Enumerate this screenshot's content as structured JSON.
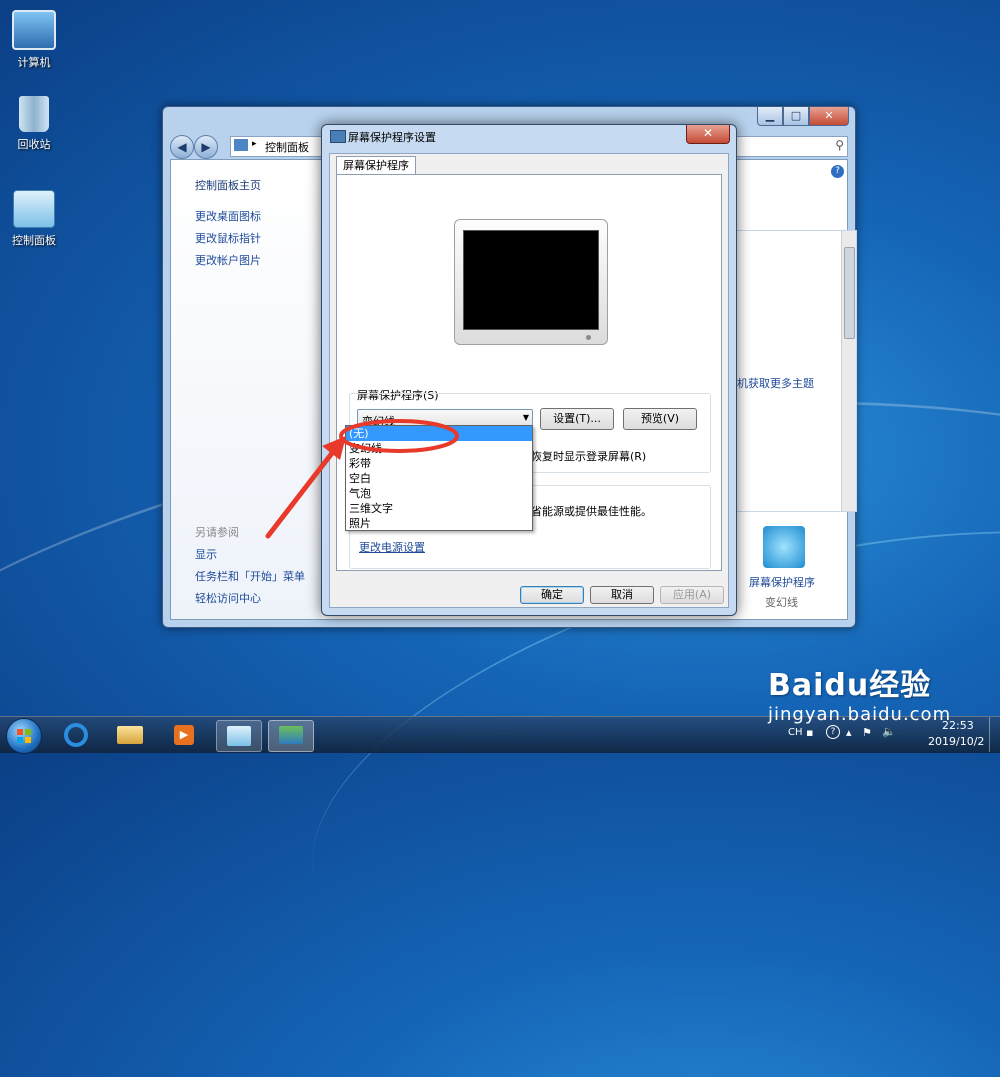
{
  "desktop": {
    "icons": [
      {
        "label": "计算机"
      },
      {
        "label": "回收站"
      },
      {
        "label": "控制面板"
      }
    ]
  },
  "control_panel": {
    "breadcrumb": "控制面板",
    "nav_left": {
      "home": "控制面板主页",
      "links": [
        "更改桌面图标",
        "更改鼠标指针",
        "更改帐户图片"
      ],
      "see_also_title": "另请参阅",
      "see_also": [
        "显示",
        "任务栏和「开始」菜单",
        "轻松访问中心"
      ]
    },
    "online_themes_link": "机获取更多主题",
    "screensaver_label": "屏幕保护程序",
    "screensaver_value": "变幻线"
  },
  "dialog": {
    "title": "屏幕保护程序设置",
    "tab": "屏幕保护程序",
    "group_label": "屏幕保护程序(S)",
    "combo_value": "变幻线",
    "settings_button": "设置(T)...",
    "preview_button": "预览(V)",
    "resume_text": "恢复时显示登录屏幕(R)",
    "power_text": "省能源或提供最佳性能。",
    "power_link": "更改电源设置",
    "ok": "确定",
    "cancel": "取消",
    "apply": "应用(A)",
    "dropdown_options": [
      "(无)",
      "变幻线",
      "彩带",
      "空白",
      "气泡",
      "三维文字",
      "照片"
    ],
    "selected_option": "(无)"
  },
  "taskbar": {
    "lang": "CH",
    "time": "22:53",
    "date": "2019/10/2"
  },
  "watermark": {
    "logo": "Baidu经验",
    "url": "jingyan.baidu.com"
  },
  "colors": {
    "link": "#1e4a99",
    "selection": "#3399ff",
    "annotation_red": "#e8392a"
  }
}
